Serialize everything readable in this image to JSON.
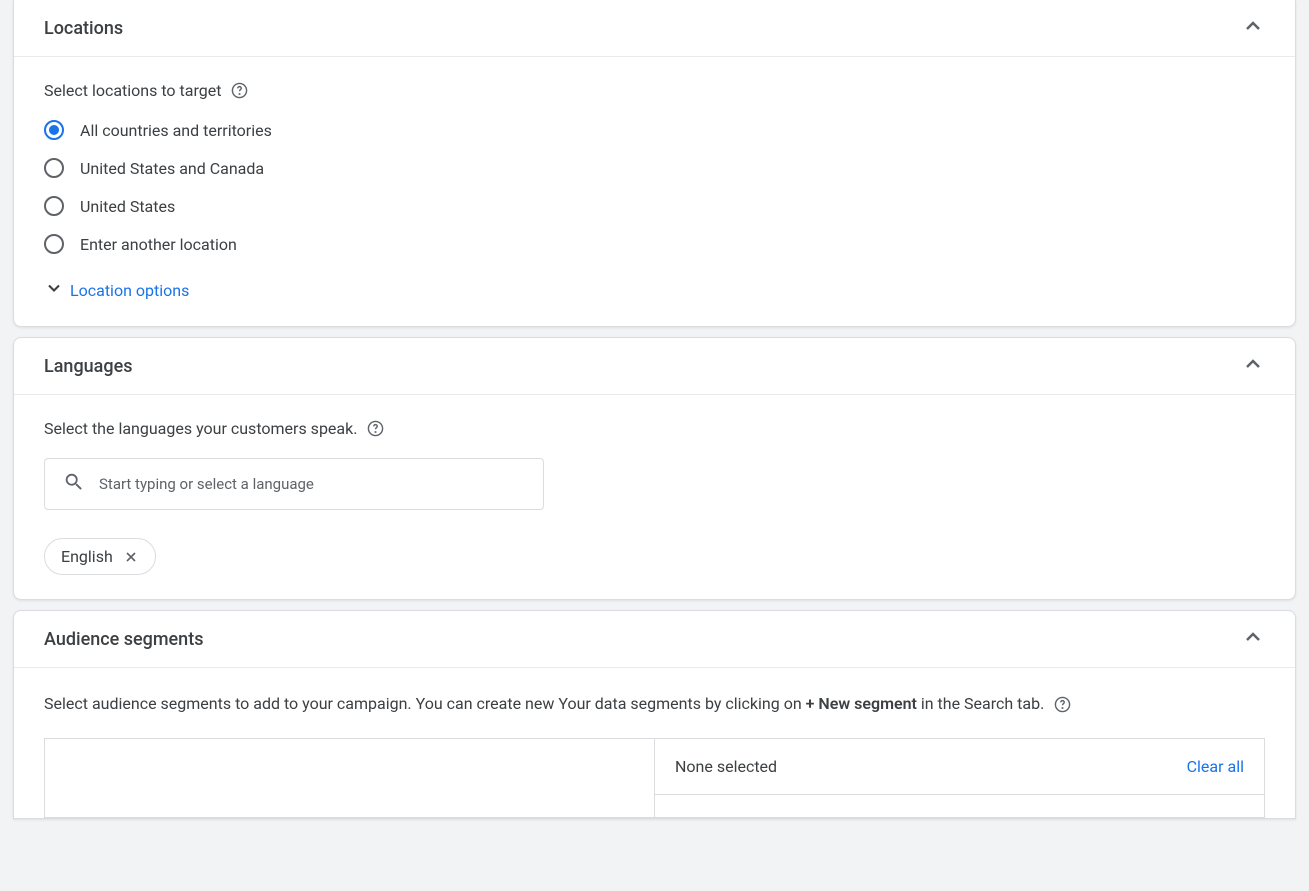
{
  "locations": {
    "title": "Locations",
    "subtitle": "Select locations to target",
    "options": [
      "All countries and territories",
      "United States and Canada",
      "United States",
      "Enter another location"
    ],
    "selected_index": 0,
    "expand_label": "Location options"
  },
  "languages": {
    "title": "Languages",
    "subtitle": "Select the languages your customers speak.",
    "search_placeholder": "Start typing or select a language",
    "chips": [
      "English"
    ]
  },
  "audience": {
    "title": "Audience segments",
    "description_pre": "Select audience segments to add to your campaign. You can create new Your data segments by clicking on ",
    "description_bold": "+ New segment",
    "description_post": " in the Search tab.",
    "none_selected": "None selected",
    "clear_all": "Clear all"
  }
}
